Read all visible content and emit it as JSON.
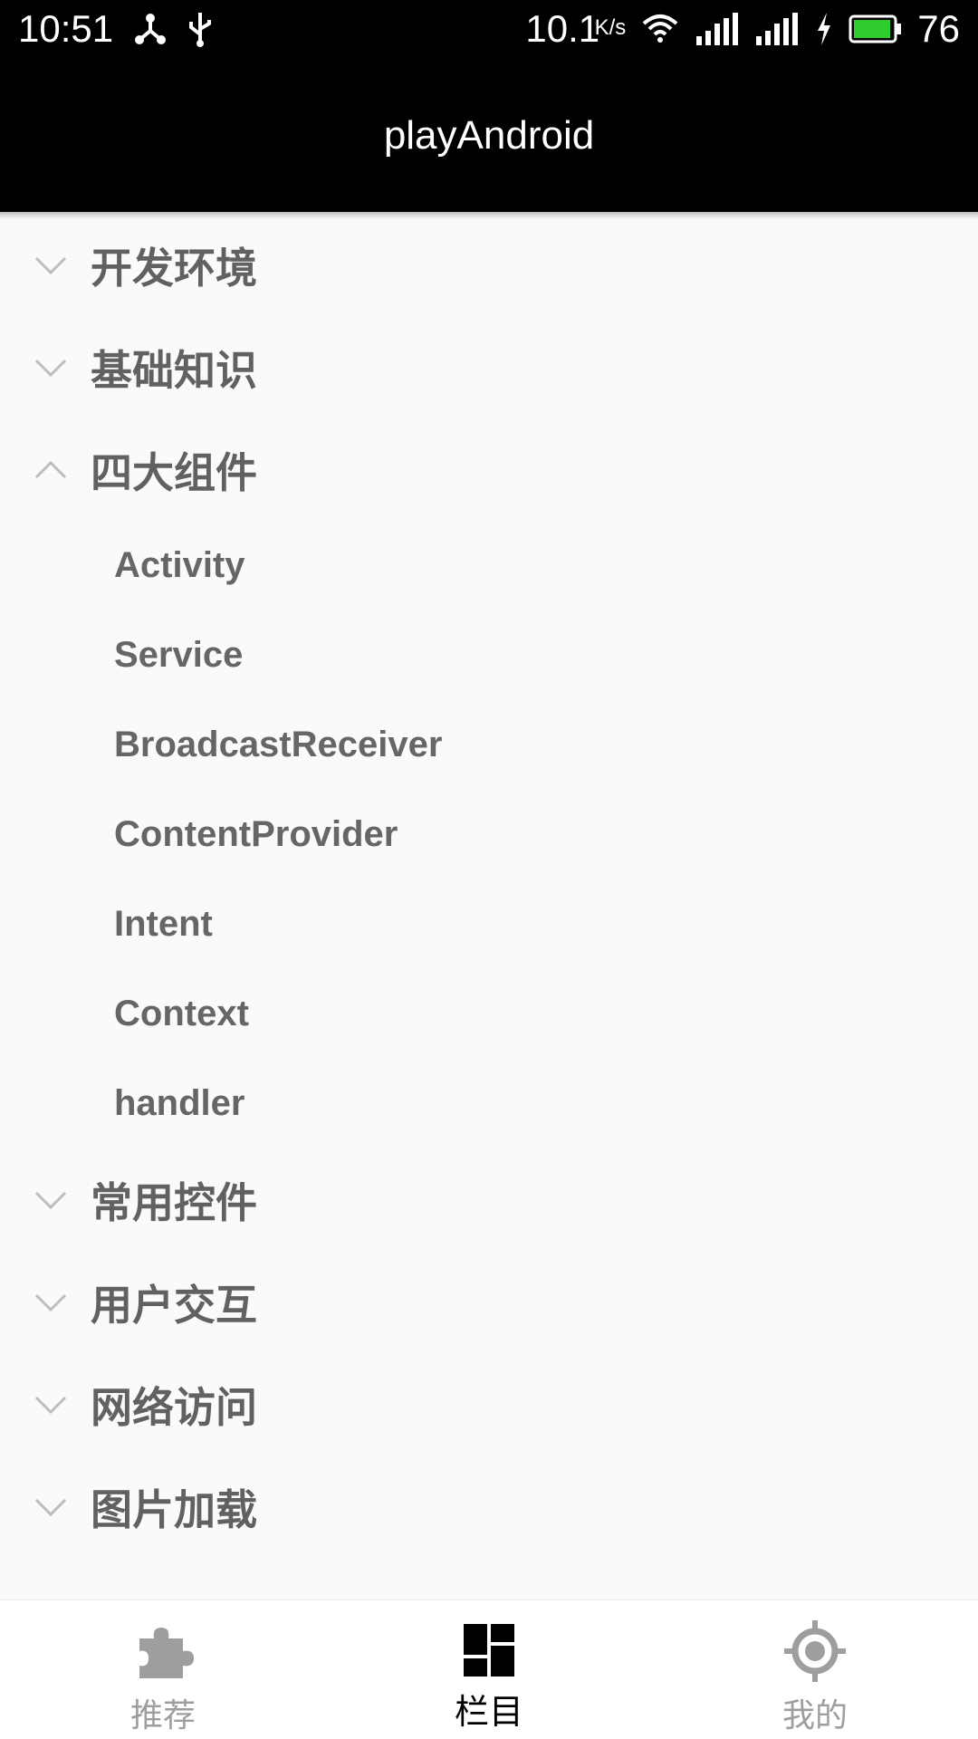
{
  "status_bar": {
    "time": "10:51",
    "network_speed": "10.1",
    "network_speed_unit": "K/s",
    "battery_percent": "76"
  },
  "appbar": {
    "title": "playAndroid"
  },
  "tree": {
    "groups": [
      {
        "label": "开发环境",
        "expanded": false
      },
      {
        "label": "基础知识",
        "expanded": false
      },
      {
        "label": "四大组件",
        "expanded": true,
        "children": [
          "Activity",
          "Service",
          "BroadcastReceiver",
          "ContentProvider",
          "Intent",
          "Context",
          "handler"
        ]
      },
      {
        "label": "常用控件",
        "expanded": false
      },
      {
        "label": "用户交互",
        "expanded": false
      },
      {
        "label": "网络访问",
        "expanded": false
      },
      {
        "label": "图片加载",
        "expanded": false
      }
    ]
  },
  "bottom_nav": {
    "items": [
      {
        "label": "推荐",
        "icon": "puzzle-icon",
        "active": false
      },
      {
        "label": "栏目",
        "icon": "dashboard-icon",
        "active": true
      },
      {
        "label": "我的",
        "icon": "target-icon",
        "active": false
      }
    ]
  },
  "colors": {
    "status_bar_bg": "#000000",
    "appbar_bg": "#000000",
    "text_secondary": "#616161",
    "nav_inactive": "#9e9e9e",
    "nav_active": "#000000",
    "battery_fill": "#2ecc2e"
  }
}
